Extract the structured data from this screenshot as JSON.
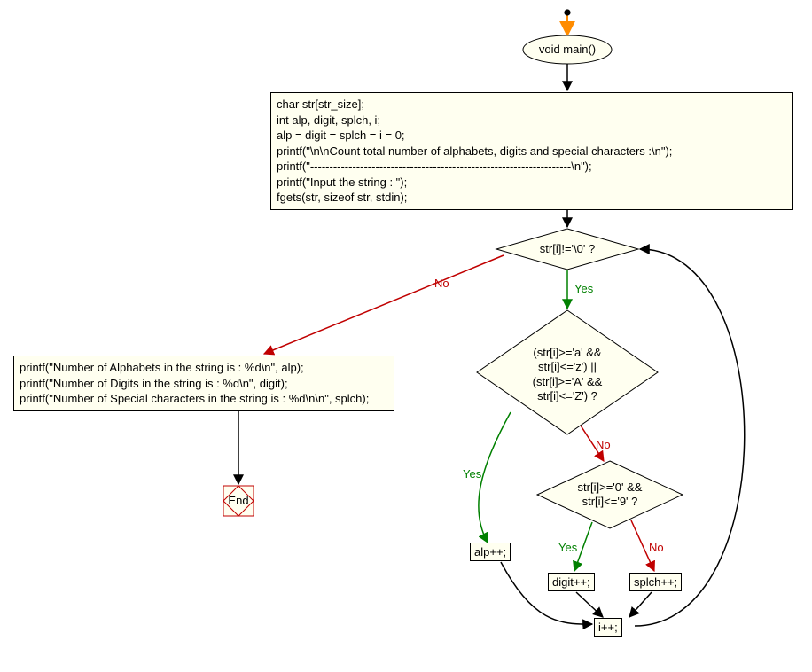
{
  "start": {
    "label": "void main()"
  },
  "init_block": {
    "l1": "char str[str_size];",
    "l2": "int alp, digit, splch, i;",
    "l3": "alp = digit = splch = i = 0;",
    "l4": "printf(\"\\n\\nCount total number of alphabets, digits and special characters :\\n\");",
    "l5": "printf(\"--------------------------------------------------------------------\\n\");",
    "l6": "printf(\"Input the string : \");",
    "l7": "fgets(str, sizeof str, stdin);"
  },
  "cond1": {
    "text": "str[i]!='\\0' ?"
  },
  "cond2": {
    "l1": "(str[i]>='a' &&",
    "l2": "str[i]<='z') ||",
    "l3": "(str[i]>='A' &&",
    "l4": "str[i]<='Z') ?"
  },
  "cond3": {
    "l1": "str[i]>='0' &&",
    "l2": "str[i]<='9' ?"
  },
  "output_block": {
    "l1": "printf(\"Number of Alphabets in the string is : %d\\n\", alp);",
    "l2": "printf(\"Number of Digits in the string is : %d\\n\", digit);",
    "l3": "printf(\"Number of Special characters in the string is : %d\\n\\n\", splch);"
  },
  "inc_alp": {
    "label": "alp++;"
  },
  "inc_digit": {
    "label": "digit++;"
  },
  "inc_splch": {
    "label": "splch++;"
  },
  "inc_i": {
    "label": "i++;"
  },
  "end": {
    "label": "End"
  },
  "labels": {
    "yes": "Yes",
    "no": "No"
  }
}
